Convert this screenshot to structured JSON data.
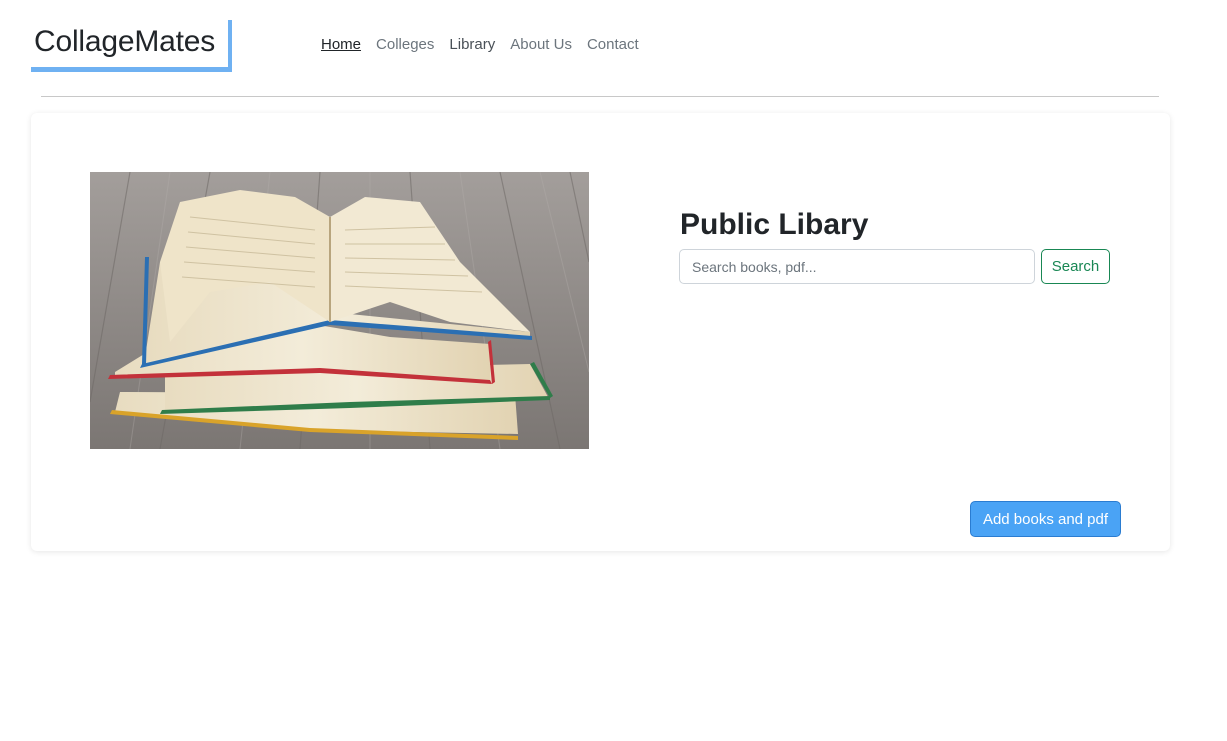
{
  "brand": {
    "name": "CollageMates",
    "accent_color": "#6fb1f2"
  },
  "nav": {
    "items": [
      {
        "label": "Home",
        "active": true
      },
      {
        "label": "Colleges",
        "active": false
      },
      {
        "label": "Library",
        "active": false
      },
      {
        "label": "About Us",
        "active": false
      },
      {
        "label": "Contact",
        "active": false
      }
    ]
  },
  "library": {
    "title": "Public Libary",
    "image": {
      "icon": "books-stack-image"
    },
    "search": {
      "placeholder": "Search books, pdf...",
      "value": "",
      "button_label": "Search",
      "button_color": "#198754"
    },
    "add_button_label": "Add books and pdf",
    "add_button_color": "#4aa3f5"
  }
}
